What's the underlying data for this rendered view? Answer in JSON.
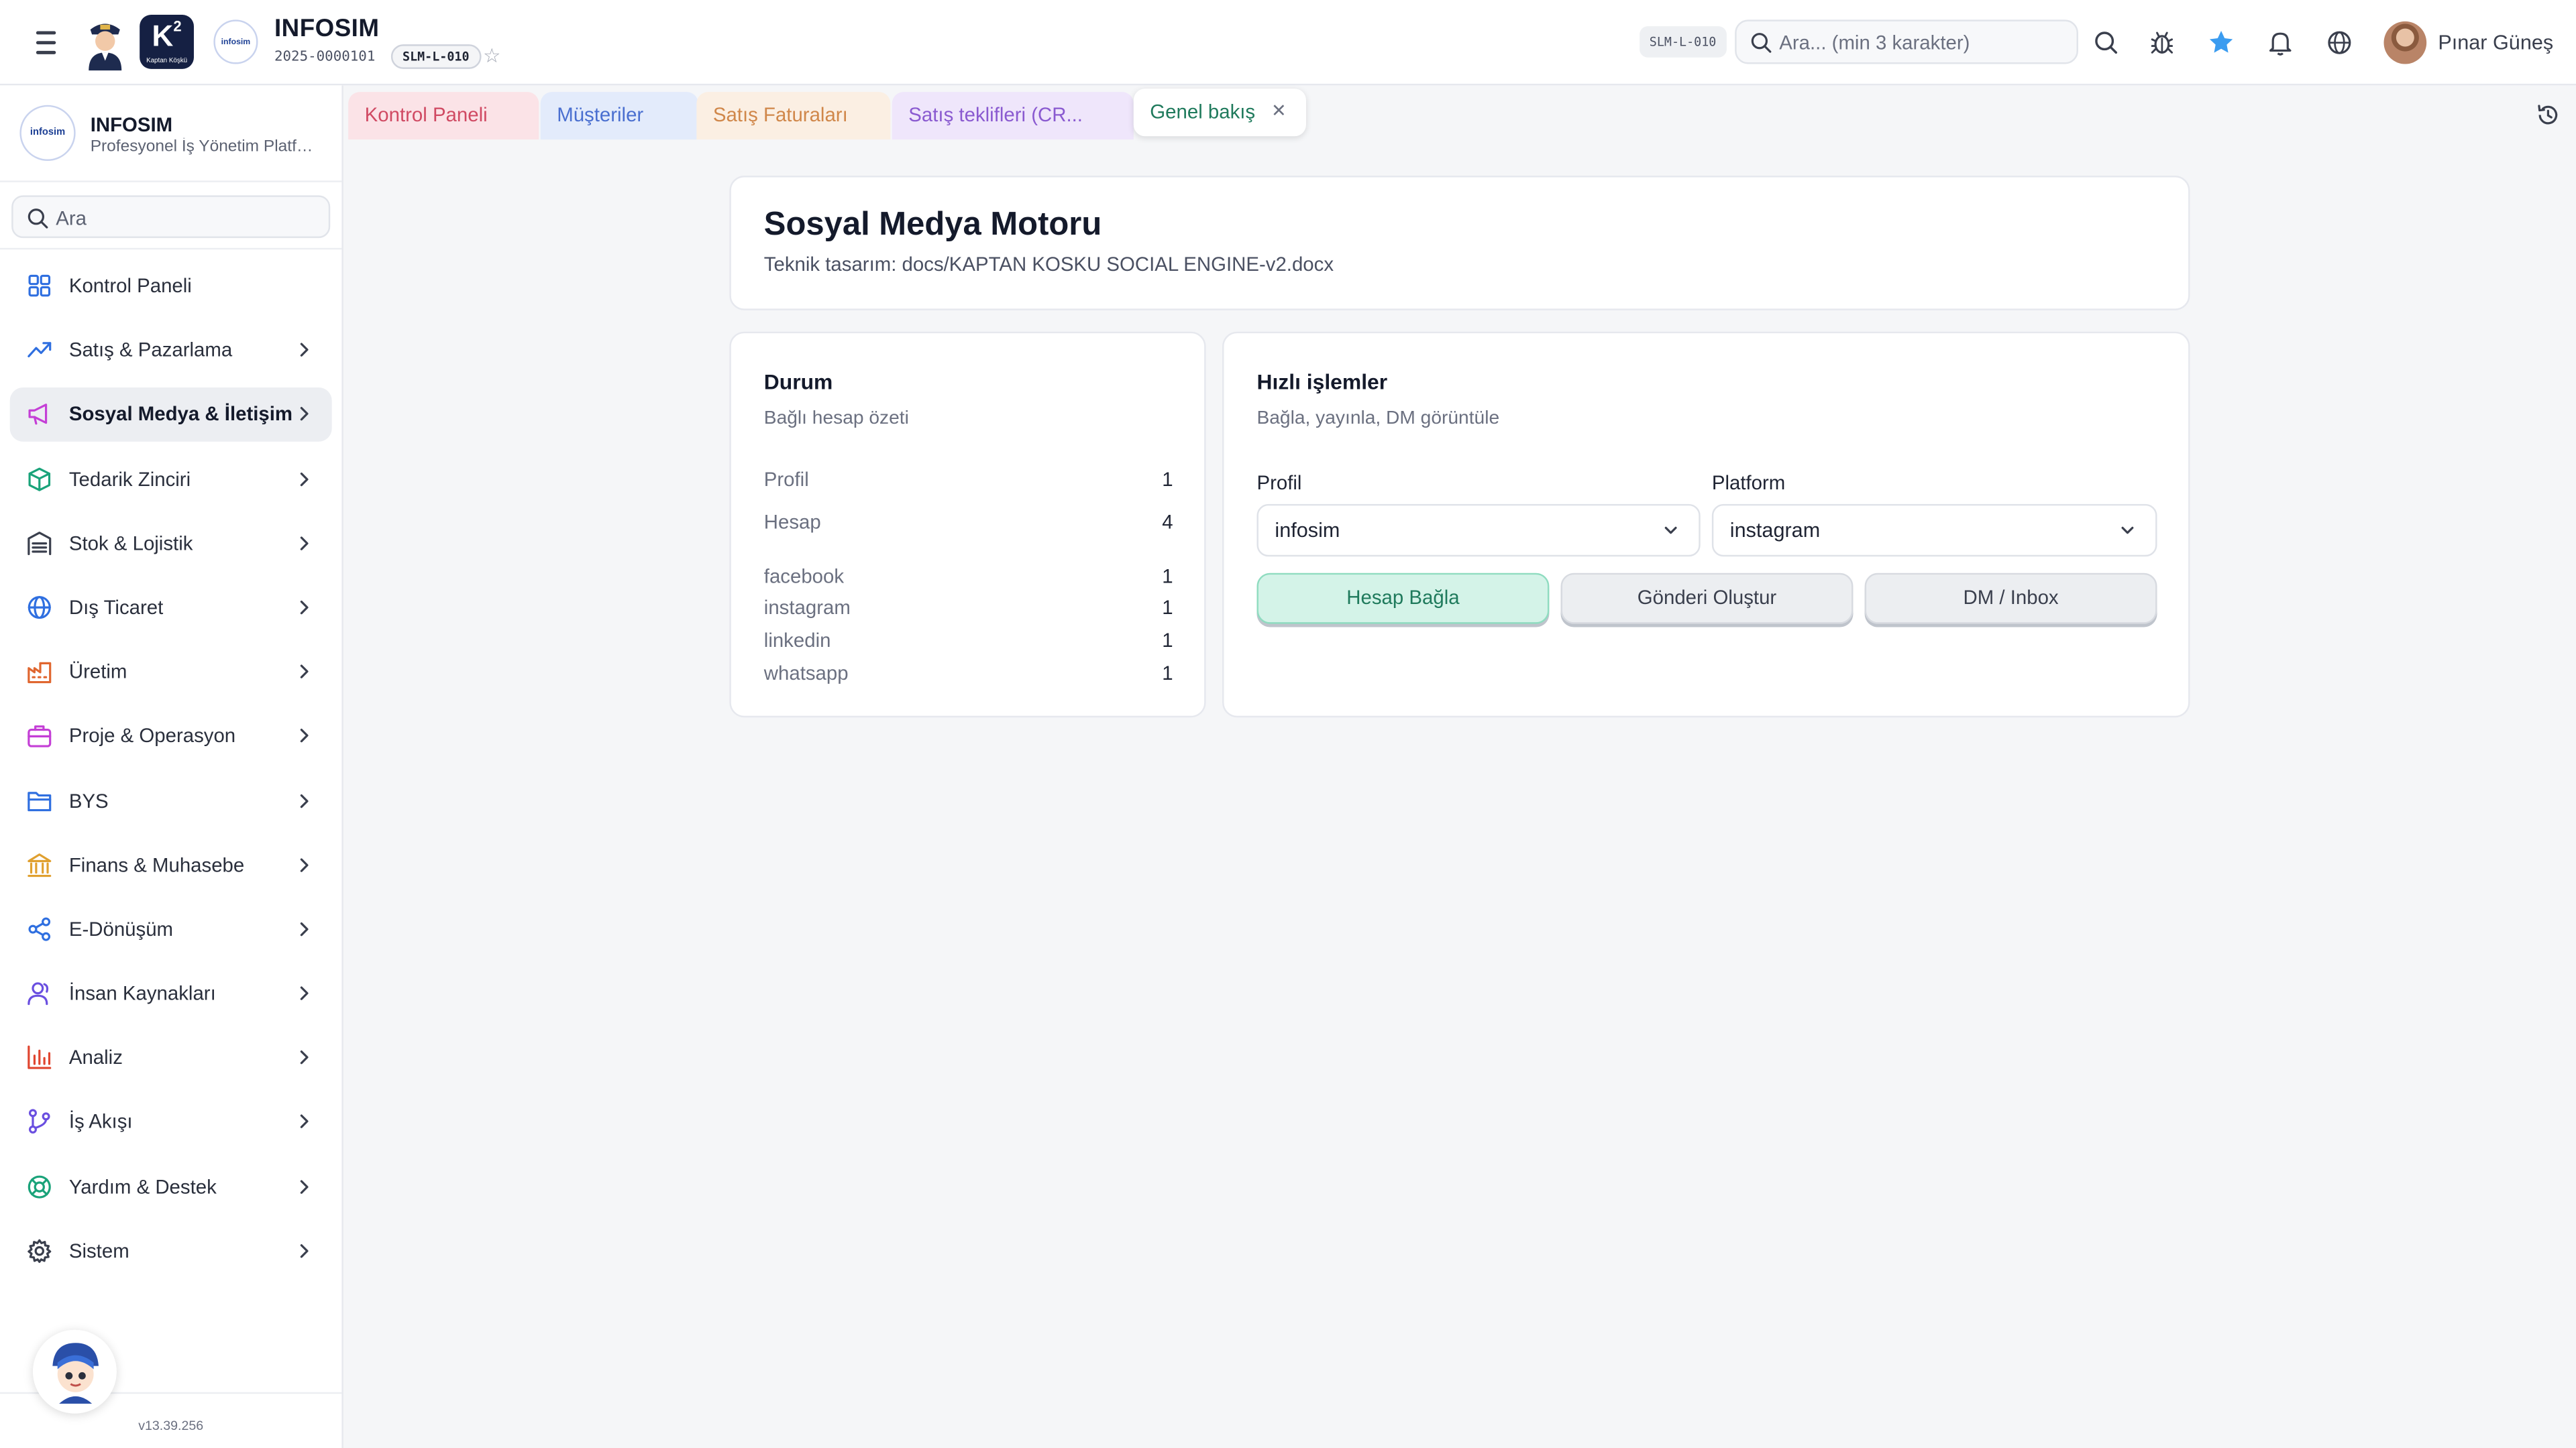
{
  "header": {
    "brand_title": "INFOSIM",
    "brand_code": "2025-0000101",
    "brand_badge": "SLM-L-010",
    "k2_logo_text": "K",
    "k2_logo_sup": "2",
    "k2_logo_caption": "Kaptan Köşkü",
    "company_logo_text": "infosim",
    "top_badge": "SLM-L-010",
    "search_placeholder": "Ara... (min 3 karakter)",
    "user_name": "Pınar Güneş",
    "accent_star_color": "#3b9cf0"
  },
  "sidebar": {
    "logo_text": "infosim",
    "title": "INFOSIM",
    "subtitle": "Profesyonel İş Yönetim Platformu",
    "search_placeholder": "Ara",
    "items": [
      {
        "label": "Kontrol Paneli",
        "icon": "grid-icon",
        "color": "#2f6fe0"
      },
      {
        "label": "Satış & Pazarlama",
        "icon": "trending-up-icon",
        "color": "#2f6fe0"
      },
      {
        "label": "Sosyal Medya & İletişim",
        "icon": "megaphone-icon",
        "color": "#c43fd6",
        "active": true
      },
      {
        "label": "Tedarik Zinciri",
        "icon": "package-icon",
        "color": "#1aa37a"
      },
      {
        "label": "Stok & Lojistik",
        "icon": "warehouse-icon",
        "color": "#3a3f4d"
      },
      {
        "label": "Dış Ticaret",
        "icon": "globe-icon",
        "color": "#2f6fe0"
      },
      {
        "label": "Üretim",
        "icon": "factory-icon",
        "color": "#e0662f"
      },
      {
        "label": "Proje & Operasyon",
        "icon": "briefcase-icon",
        "color": "#c43fd6"
      },
      {
        "label": "BYS",
        "icon": "folder-icon",
        "color": "#2f6fe0"
      },
      {
        "label": "Finans & Muhasebe",
        "icon": "bank-icon",
        "color": "#e0a02f"
      },
      {
        "label": "E-Dönüşüm",
        "icon": "share-icon",
        "color": "#2f6fe0"
      },
      {
        "label": "İnsan Kaynakları",
        "icon": "users-icon",
        "color": "#6a4fe0"
      },
      {
        "label": "Analiz",
        "icon": "bar-chart-icon",
        "color": "#e0452f"
      },
      {
        "label": "İş Akışı",
        "icon": "git-branch-icon",
        "color": "#6a4fe0"
      },
      {
        "label": "Yardım & Destek",
        "icon": "lifebuoy-icon",
        "color": "#1aa37a"
      },
      {
        "label": "Sistem",
        "icon": "gear-icon",
        "color": "#3a3f4d"
      }
    ],
    "version": "v13.39.256"
  },
  "tabs": [
    {
      "label": "Kontrol Paneli",
      "bg": "#fbe3e7",
      "color": "#d04a63"
    },
    {
      "label": "Müşteriler",
      "bg": "#e3ebfb",
      "color": "#4a6fd0"
    },
    {
      "label": "Satış Faturaları",
      "bg": "#fbefe3",
      "color": "#d0874a"
    },
    {
      "label": "Satış teklifleri (CR...",
      "bg": "#efe6fb",
      "color": "#8a5ad0"
    },
    {
      "label": "Genel bakış",
      "active": true
    }
  ],
  "page": {
    "title": "Sosyal Medya Motoru",
    "subtitle": "Teknik tasarım: docs/KAPTAN KOSKU SOCIAL ENGINE-v2.docx"
  },
  "status_card": {
    "title": "Durum",
    "description": "Bağlı hesap özeti",
    "summary": [
      {
        "label": "Profil",
        "value": "1"
      },
      {
        "label": "Hesap",
        "value": "4"
      }
    ],
    "platforms": [
      {
        "label": "facebook",
        "value": "1"
      },
      {
        "label": "instagram",
        "value": "1"
      },
      {
        "label": "linkedin",
        "value": "1"
      },
      {
        "label": "whatsapp",
        "value": "1"
      }
    ]
  },
  "actions_card": {
    "title": "Hızlı işlemler",
    "description": "Bağla, yayınla, DM görüntüle",
    "profile_label": "Profil",
    "profile_value": "infosim",
    "platform_label": "Platform",
    "platform_value": "instagram",
    "buttons": {
      "connect": "Hesap Bağla",
      "create_post": "Gönderi Oluştur",
      "dm_inbox": "DM / Inbox"
    }
  }
}
